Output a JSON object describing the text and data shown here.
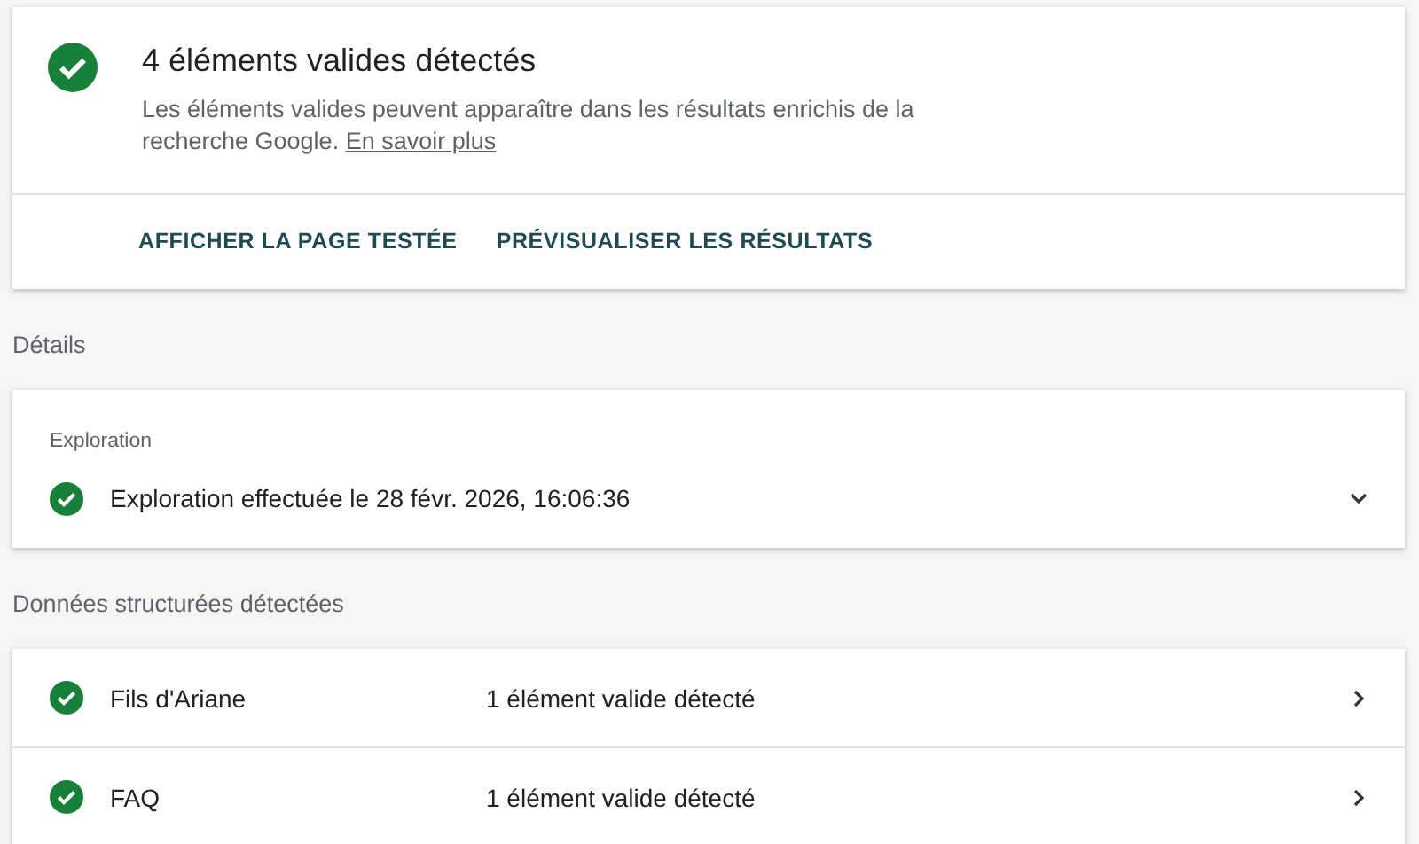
{
  "summary": {
    "title": "4 éléments valides détectés",
    "description": "Les éléments valides peuvent apparaître dans les résultats enrichis de la recherche Google.",
    "link": "En savoir plus",
    "actions": [
      "AFFICHER LA PAGE TESTÉE",
      "PRÉVISUALISER LES RÉSULTATS"
    ]
  },
  "details": {
    "heading": "Détails",
    "crawl": {
      "label": "Exploration",
      "status": "Exploration effectuée le 28 févr. 2026, 16:06:36",
      "expanded": false
    }
  },
  "structured_data": {
    "heading": "Données structurées détectées",
    "items": [
      {
        "name": "Fils d'Ariane",
        "result": "1 élément valide détecté"
      },
      {
        "name": "FAQ",
        "result": "1 élément valide détecté"
      }
    ]
  }
}
